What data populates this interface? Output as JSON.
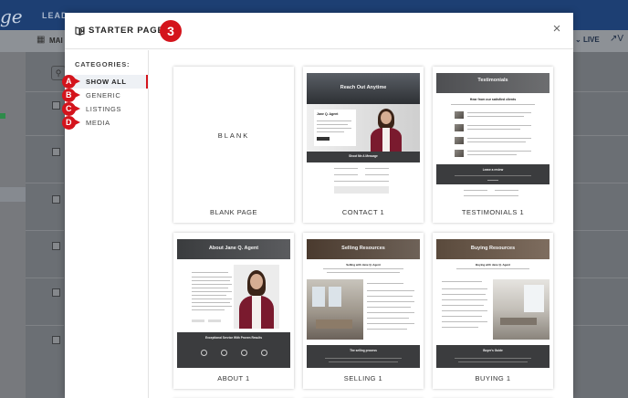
{
  "background": {
    "logo_text": "ge",
    "nav_label": "LEAD",
    "toolbar_label": "MAI",
    "live_label": "LIVE",
    "external_label": "V"
  },
  "modal": {
    "title": "STARTER PAGES:",
    "step_badge": "3",
    "close_icon": "close-icon",
    "header_icon": "book-open-icon",
    "accent_color": "#d4141c"
  },
  "categories": {
    "heading": "CATEGORIES:",
    "items": [
      {
        "badge": "A",
        "label": "SHOW ALL",
        "active": true
      },
      {
        "badge": "B",
        "label": "GENERIC",
        "active": false
      },
      {
        "badge": "C",
        "label": "LISTINGS",
        "active": false
      },
      {
        "badge": "D",
        "label": "MEDIA",
        "active": false
      }
    ]
  },
  "templates": [
    {
      "caption": "BLANK PAGE",
      "thumb_word": "BLANK"
    },
    {
      "caption": "CONTACT 1",
      "hero_title": "Reach Out Anytime",
      "agent_name": "Jane Q. Agent",
      "footer_title": "Shoot Me A Message"
    },
    {
      "caption": "TESTIMONIALS 1",
      "hero_title": "Testimonials",
      "section_title": "Hear from our satisfied clients",
      "footer_title": "Leave a review"
    },
    {
      "caption": "ABOUT 1",
      "hero_title": "About Jane Q. Agent",
      "footer_title": "Exceptional Service With Proven Results"
    },
    {
      "caption": "SELLING 1",
      "hero_title": "Selling Resources",
      "section_title": "Selling with Jane Q. Agent",
      "footer_title": "The selling process"
    },
    {
      "caption": "BUYING 1",
      "hero_title": "Buying Resources",
      "section_title": "Buying with Jane Q. Agent",
      "footer_title": "Buyer's Guide"
    }
  ]
}
